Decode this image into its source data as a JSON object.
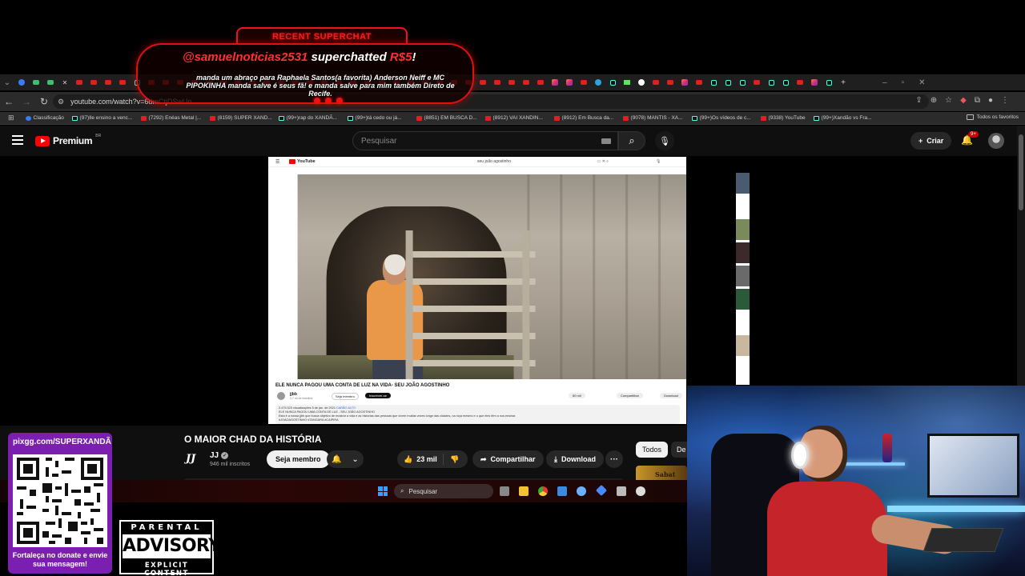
{
  "browser": {
    "url": "youtube.com/watch?v=6dmCtjDSwUo",
    "bookmarks": [
      "Classificação",
      "(97)Ile ensino a venc...",
      "(7292) Enéas Metal |...",
      "(8159) SUPER XAND...",
      "(99+)rap do XANDÃ...",
      "(99+)tá cedo ou já...",
      "(8851) EM BUSCA D...",
      "(8912) VAI XANDIN...",
      "(8912) Em Busca da...",
      "(9078) MANTIS - XA...",
      "(99+)Os vídeos de c...",
      "(9338) YouTube",
      "(99+)Xandão vs Fra..."
    ],
    "all_bookmarks": "Todos os favoritos"
  },
  "youtube": {
    "logo": "Premium",
    "region": "BR",
    "search_placeholder": "Pesquisar",
    "create": "Criar",
    "notif_badge": "9+"
  },
  "inner": {
    "logo": "YouTube",
    "search_value": "seu joão agostinho",
    "title": "ELE NUNCA PAGOU UMA CONTA DE LUZ NA VIDA- SEU JOÃO AGOSTINHO",
    "channel": "jjbb",
    "subs": "2,7 mi de inscritos",
    "member": "Seja membro",
    "subscribe": "Inscrever-se",
    "likes": "60 mil",
    "share": "Compartilhar",
    "download": "Download",
    "desc_line1": "2.479.323 visualizações  5 de jan. de 2021",
    "desc_tag": "CARÃO ALTO",
    "desc_line2": "ELE NUNCA PAGOU UMA CONTA DE LUZ - SEU JOÃO AGOSTINHO",
    "desc_line3": "Esta é a nossa jjbb que busca objetivo de mostrar a vida e as histórias das pessoas que vivem muitas vezes longe das cidades, na roça mesmo e o que eles têm a nos ensinar.",
    "desc_line4": "#JOAOAGOSTINHO #TANGARA #CAIPIRA"
  },
  "video": {
    "title": "O MAIOR CHAD DA HISTÓRIA",
    "channel": "JJ",
    "channel_logo": "JJ",
    "subs": "946 mil inscritos",
    "member": "Seja membro",
    "likes": "23 mil",
    "share": "Compartilhar",
    "download": "Download",
    "chip_all": "Todos",
    "chip_second": "De",
    "side_thumb": "Sabat"
  },
  "taskbar": {
    "search": "Pesquisar"
  },
  "superchat": {
    "header": "RECENT SUPERCHAT",
    "user": "@samuelnoticias2531",
    "action": "superchatted",
    "amount": "R$5",
    "exclaim": "!",
    "message": "manda um abraço para Raphaela Santos(a favorita) Anderson Neiff e MC PIPOKINHA manda salve é seus fã! e manda salve para mim também Direto de Recife."
  },
  "pix": {
    "url": "pixgg.com/SUPERXANDÃ",
    "caption": "Fortaleça no donate e envie sua mensagem!"
  },
  "advisory": {
    "top": "PARENTAL",
    "middle": "ADVISORY",
    "bottom": "EXPLICIT CONTENT"
  },
  "colors": {
    "yt_red": "#ff0000",
    "superchat_red": "#ff3030",
    "pix_purple": "#7a1fb0",
    "bg": "#0f0f0f"
  }
}
